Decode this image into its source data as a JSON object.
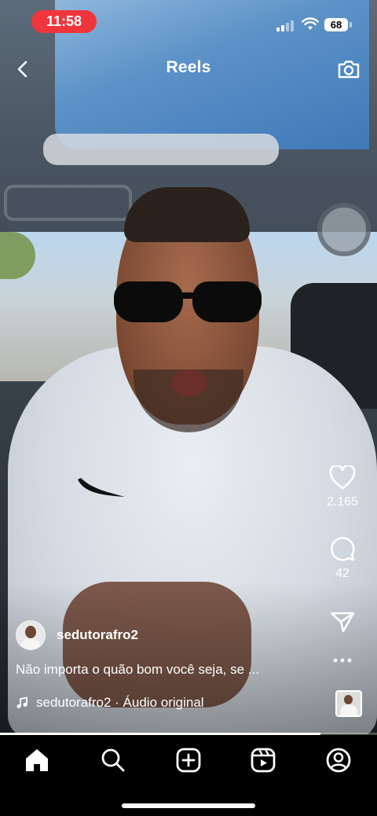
{
  "status_bar": {
    "time": "11:58",
    "battery": "68",
    "time_pill_color": "#f0353c"
  },
  "header": {
    "title": "Reels",
    "back_icon": "chevron-left-icon",
    "camera_icon": "camera-icon"
  },
  "actions": {
    "likes": "2.165",
    "comments": "42",
    "icons": [
      "heart-icon",
      "comment-icon",
      "send-icon",
      "more-icon"
    ]
  },
  "reel": {
    "username": "sedutorafro2",
    "caption": "Não importa o quão bom você seja, se ...",
    "audio": "sedutorafro2 · Áudio original",
    "progress_fraction": 0.85
  },
  "bottom_nav": {
    "items": [
      "home-icon",
      "search-icon",
      "create-icon",
      "reels-icon",
      "profile-icon"
    ]
  }
}
